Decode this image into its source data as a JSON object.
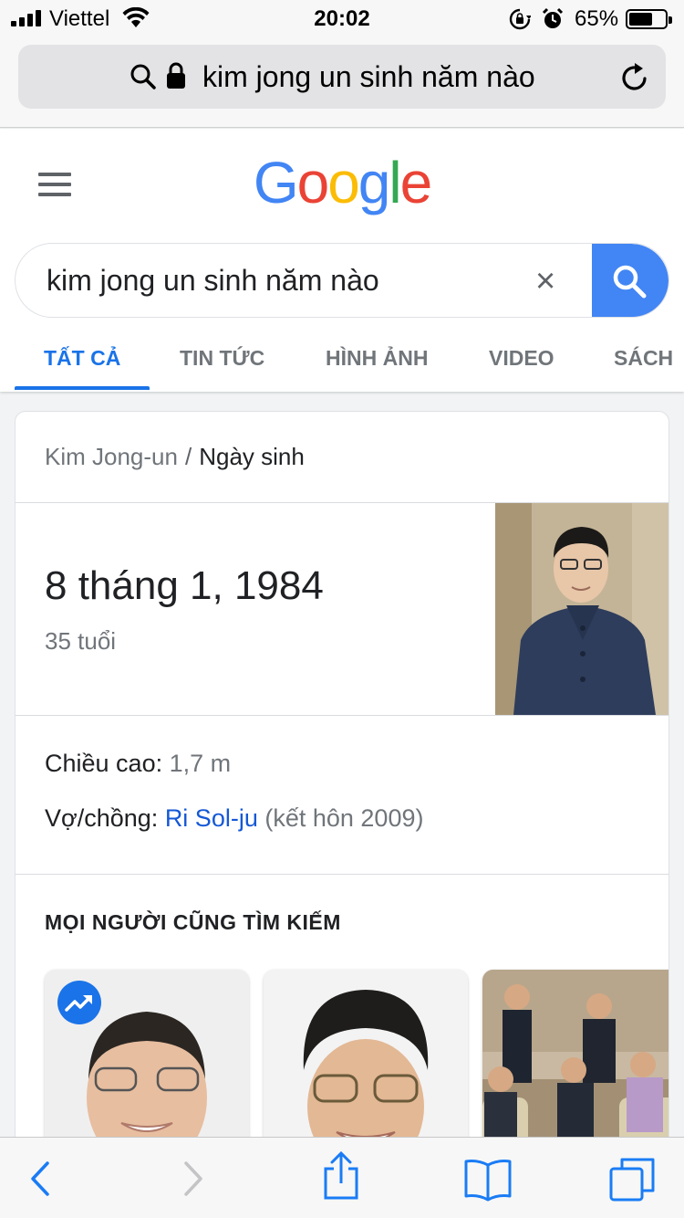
{
  "status_bar": {
    "carrier": "Viettel",
    "time": "20:02",
    "battery_percent": "65%",
    "battery_level": 0.65,
    "icons": [
      "signal-icon",
      "wifi-icon",
      "rotation-lock-icon",
      "alarm-icon",
      "battery-icon"
    ]
  },
  "browser": {
    "url_text": "kim jong un sinh năm nào",
    "icons": [
      "search-icon",
      "lock-icon",
      "reload-icon"
    ]
  },
  "google": {
    "logo": [
      "G",
      "o",
      "o",
      "g",
      "l",
      "e"
    ],
    "logo_colors": [
      "#4285F4",
      "#EA4335",
      "#FBBC05",
      "#4285F4",
      "#34A853",
      "#EA4335"
    ],
    "query": "kim jong un sinh năm nào",
    "clear_label": "×",
    "tabs": [
      "TẤT CẢ",
      "TIN TỨC",
      "HÌNH ẢNH",
      "VIDEO",
      "SÁCH"
    ],
    "active_tab": "TẤT CẢ",
    "accent": "#1a73e8"
  },
  "card": {
    "breadcrumb_entity": "Kim Jong-un",
    "breadcrumb_sep": "/",
    "breadcrumb_attr": "Ngày sinh",
    "answer": "8 tháng 1, 1984",
    "age": "35 tuổi",
    "height_label": "Chiều cao:",
    "height_value": "1,7 m",
    "spouse_label": "Vợ/chồng:",
    "spouse_link": "Ri Sol-ju",
    "spouse_note": "(kết hôn 2009)",
    "people_header": "MỌI NGƯỜI CŨNG TÌM KIẾM"
  },
  "toolbar": {
    "icons": [
      "back-icon",
      "forward-icon",
      "share-icon",
      "bookmarks-icon",
      "tabs-icon"
    ]
  }
}
